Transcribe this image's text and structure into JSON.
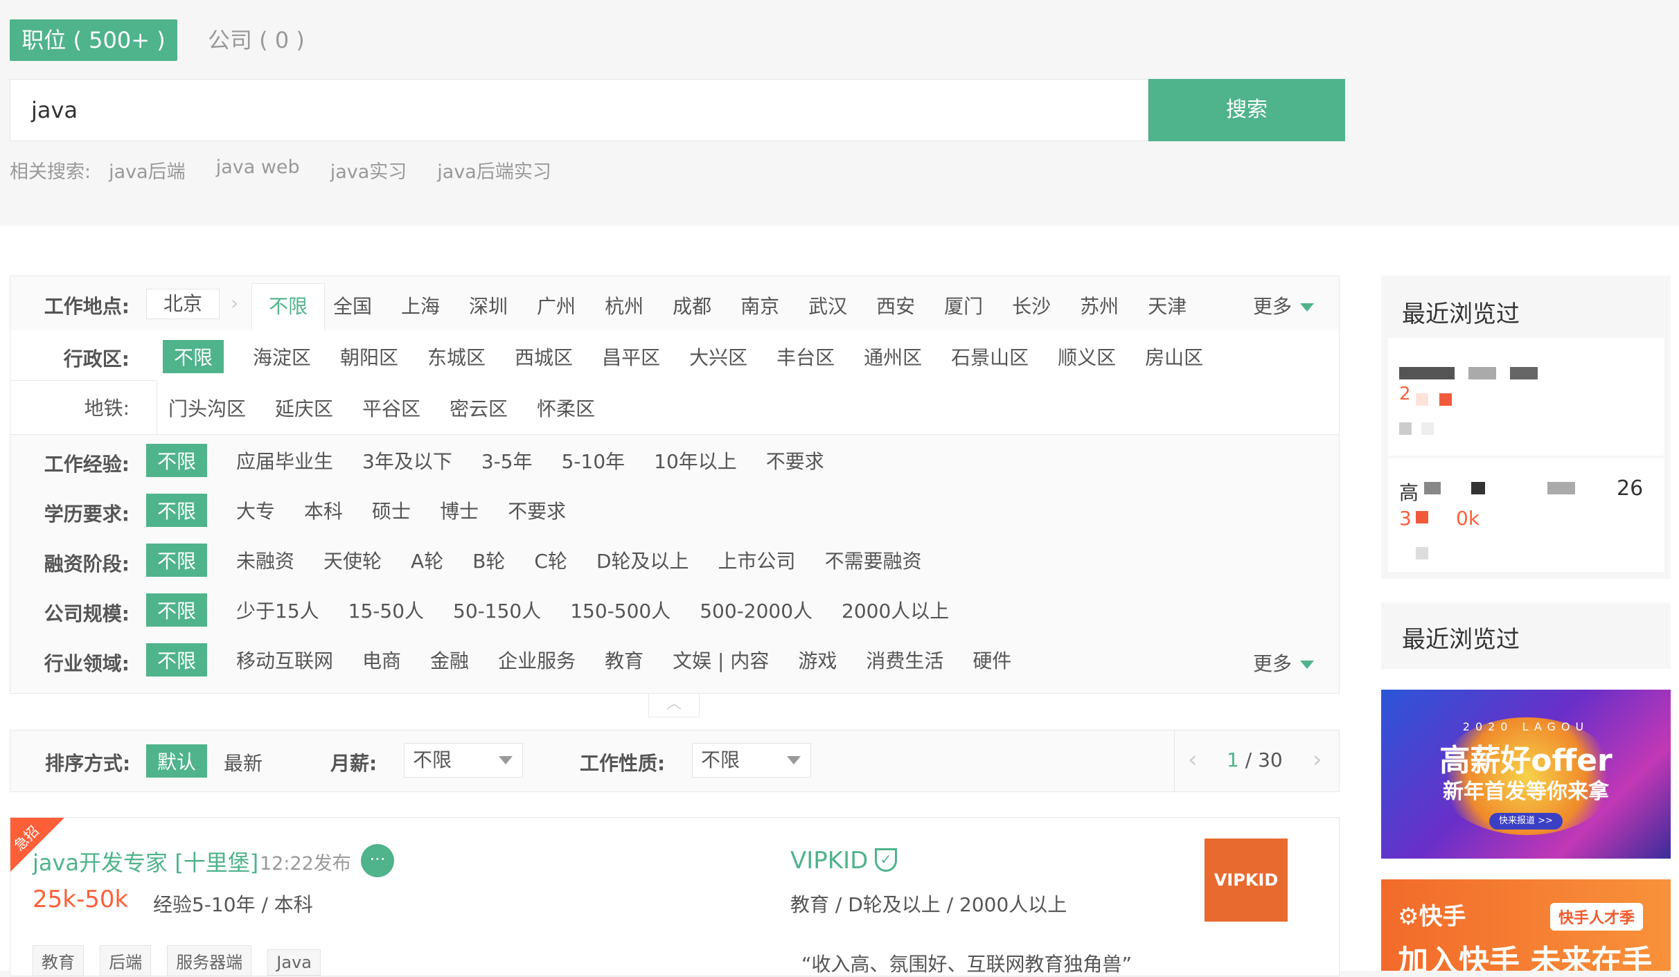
{
  "tabs": {
    "jobs": "职位 ( 500+ )",
    "company": "公司 ( 0 )"
  },
  "search": {
    "value": "java",
    "button": "搜索"
  },
  "related": {
    "label": "相关搜索:",
    "items": [
      "java后端",
      "java web",
      "java实习",
      "java后端实习"
    ]
  },
  "filters": {
    "location": {
      "label": "工作地点:",
      "current_city": "北京",
      "options": [
        "不限",
        "全国",
        "上海",
        "深圳",
        "广州",
        "杭州",
        "成都",
        "南京",
        "武汉",
        "西安",
        "厦门",
        "长沙",
        "苏州",
        "天津"
      ],
      "more": "更多"
    },
    "district": {
      "label": "行政区:",
      "options": [
        "不限",
        "海淀区",
        "朝阳区",
        "东城区",
        "西城区",
        "昌平区",
        "大兴区",
        "丰台区",
        "通州区",
        "石景山区",
        "顺义区",
        "房山区"
      ]
    },
    "subway": {
      "label": "地铁:",
      "options": [
        "门头沟区",
        "延庆区",
        "平谷区",
        "密云区",
        "怀柔区"
      ]
    },
    "experience": {
      "label": "工作经验:",
      "options": [
        "不限",
        "应届毕业生",
        "3年及以下",
        "3-5年",
        "5-10年",
        "10年以上",
        "不要求"
      ]
    },
    "education": {
      "label": "学历要求:",
      "options": [
        "不限",
        "大专",
        "本科",
        "硕士",
        "博士",
        "不要求"
      ]
    },
    "funding": {
      "label": "融资阶段:",
      "options": [
        "不限",
        "未融资",
        "天使轮",
        "A轮",
        "B轮",
        "C轮",
        "D轮及以上",
        "上市公司",
        "不需要融资"
      ]
    },
    "scale": {
      "label": "公司规模:",
      "options": [
        "不限",
        "少于15人",
        "15-50人",
        "50-150人",
        "150-500人",
        "500-2000人",
        "2000人以上"
      ]
    },
    "industry": {
      "label": "行业领域:",
      "options": [
        "不限",
        "移动互联网",
        "电商",
        "金融",
        "企业服务",
        "教育",
        "文娱 | 内容",
        "游戏",
        "消费生活",
        "硬件"
      ],
      "more": "更多"
    }
  },
  "sort": {
    "label": "排序方式:",
    "default": "默认",
    "latest": "最新",
    "salary_label": "月薪:",
    "salary_value": "不限",
    "nature_label": "工作性质:",
    "nature_value": "不限",
    "page_current": "1",
    "page_total": "/ 30"
  },
  "job": {
    "badge": "急招",
    "title": "java开发专家 [十里堡]",
    "time": "12:22发布",
    "salary": "25k-50k",
    "requirement": "经验5-10年 / 本科",
    "company": "VIPKID",
    "company_info": "教育 / D轮及以上 / 2000人以上",
    "quote": "“收入高、氛围好、互联网教育独角兽”",
    "tags": [
      "教育",
      "后端",
      "服务器端",
      "Java"
    ],
    "logo_text": "VIPKID"
  },
  "sidebar": {
    "recent_title_1": "最近浏览过",
    "recent_title_2": "最近浏览过",
    "item2_number": "26",
    "item2_salary_tail": "0k",
    "item2_prefix": "高",
    "item2_salary_head": "3",
    "item1_salary_head": "2",
    "banner1_brand": "2020 LAGOU",
    "banner1_title": "高薪好offer",
    "banner1_subtitle": "新年首发等你来拿",
    "banner1_cta": "快来报道 >>",
    "banner2_brand": "快手",
    "banner2_badge": "快手人才季",
    "banner2_title": "加入快手 未来在手"
  },
  "colors": {
    "accent": "#4fb38b",
    "salary": "#fd5f39",
    "banner1": "#5a2fc2",
    "banner2": "#f7702d"
  }
}
